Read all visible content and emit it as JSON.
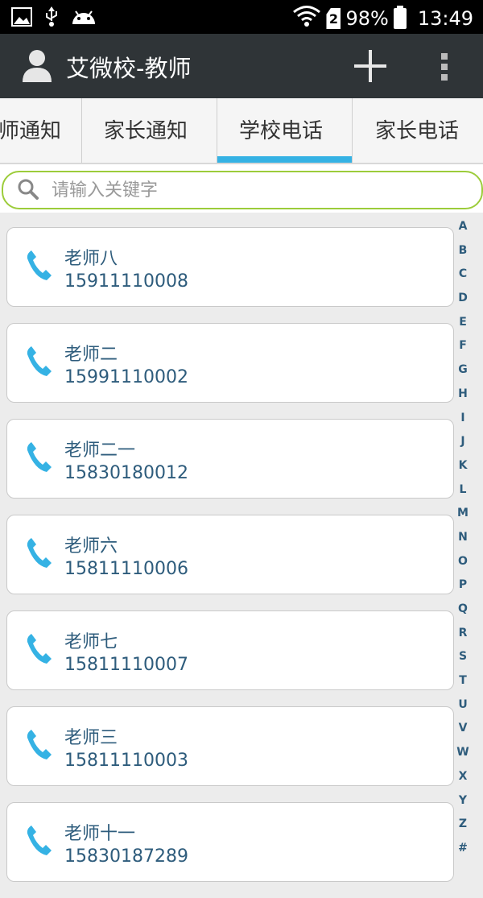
{
  "status_bar": {
    "battery": "98%",
    "time": "13:49",
    "sim_label": "2"
  },
  "action_bar": {
    "title": "艾微校-教师"
  },
  "tabs": [
    {
      "label": "教师通知"
    },
    {
      "label": "家长通知"
    },
    {
      "label": "学校电话",
      "selected": true
    },
    {
      "label": "家长电话"
    }
  ],
  "search": {
    "placeholder": "请输入关键字",
    "value": ""
  },
  "contacts": [
    {
      "name": "老师八",
      "phone": "15911110008"
    },
    {
      "name": "老师二",
      "phone": "15991110002"
    },
    {
      "name": "老师二一",
      "phone": "15830180012"
    },
    {
      "name": "老师六",
      "phone": "15811110006"
    },
    {
      "name": "老师七",
      "phone": "15811110007"
    },
    {
      "name": "老师三",
      "phone": "15811110003"
    },
    {
      "name": "老师十一",
      "phone": "15830187289"
    }
  ],
  "alphabet_index": [
    "A",
    "B",
    "C",
    "D",
    "E",
    "F",
    "G",
    "H",
    "I",
    "J",
    "K",
    "L",
    "M",
    "N",
    "O",
    "P",
    "Q",
    "R",
    "S",
    "T",
    "U",
    "V",
    "W",
    "X",
    "Y",
    "Z",
    "#"
  ],
  "colors": {
    "accent": "#35b2e4",
    "search_border": "#9ccc3a",
    "text_primary": "#2e5c7c",
    "action_bar": "#2f3437"
  }
}
